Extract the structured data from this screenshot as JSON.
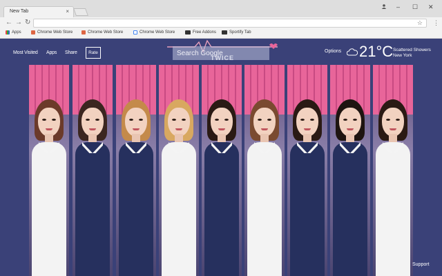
{
  "browser": {
    "tab_title": "New Tab",
    "tab_close": "×",
    "win_min": "–",
    "win_max": "☐",
    "win_close": "✕",
    "account_icon": "account-icon",
    "url_value": "",
    "menu_icon": "⋮",
    "star_icon": "☆"
  },
  "bookmarks": [
    {
      "label": "Apps",
      "icon": "apps-icon"
    },
    {
      "label": "Chrome Web Store",
      "icon": "chrome-store-icon"
    },
    {
      "label": "Chrome Web Store",
      "icon": "chrome-store-icon"
    },
    {
      "label": "Chrome Web Store",
      "icon": "google-icon"
    },
    {
      "label": "Free Addons",
      "icon": "addons-icon"
    },
    {
      "label": "Sportify Tab",
      "icon": "addons-icon"
    }
  ],
  "newtab": {
    "menu": {
      "most_visited": "Most Visited",
      "apps": "Apps",
      "share": "Share",
      "rate": "Rate"
    },
    "logo_sub": "TWICE",
    "search_placeholder": "Search Google",
    "options": "Options",
    "weather": {
      "temp": "21°C",
      "condition": "Scattered Showers",
      "location": "New York",
      "icon": "cloud-icon"
    },
    "support": "Support"
  },
  "colors": {
    "page_bg": "#3a4178",
    "pink": "#e8659a",
    "navy": "#26305e",
    "white_shirt": "#f3f3f3"
  }
}
